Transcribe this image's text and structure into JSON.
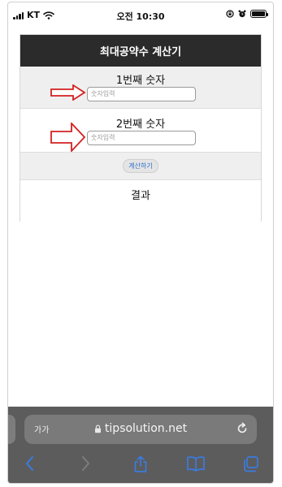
{
  "status_bar": {
    "carrier": "KT",
    "time": "오전 10:30"
  },
  "calculator": {
    "title": "최대공약수 계산기",
    "first_label": "1번째 숫자",
    "first_placeholder": "숫자입력",
    "second_label": "2번째 숫자",
    "second_placeholder": "숫자입력",
    "calculate_button": "계산하기",
    "result_label": "결과"
  },
  "browser": {
    "text_size_label": "가가",
    "url": "tipsolution.net"
  },
  "colors": {
    "header_bg": "#2b2b2b",
    "annotation_arrow": "#d42020",
    "button_text": "#2a6fc9",
    "toolbar_icon": "#3a7be0"
  },
  "icons": {
    "status": [
      "signal-icon",
      "wifi-icon",
      "lock-rotation-icon",
      "alarm-icon",
      "battery-icon"
    ],
    "toolbar": [
      "back-icon",
      "forward-icon",
      "share-icon",
      "bookmarks-icon",
      "tabs-icon"
    ]
  }
}
